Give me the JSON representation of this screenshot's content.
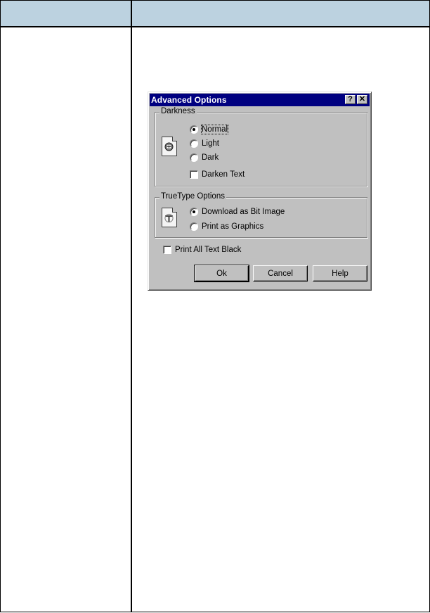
{
  "dialog": {
    "title": "Advanced Options",
    "help_button": "?",
    "close_button": "✕",
    "darkness": {
      "label": "Darkness",
      "options": [
        {
          "label": "Normal",
          "selected": true
        },
        {
          "label": "Light",
          "selected": false
        },
        {
          "label": "Dark",
          "selected": false
        }
      ],
      "darken_text": {
        "label": "Darken Text",
        "checked": false
      }
    },
    "truetype": {
      "label": "TrueType Options",
      "options": [
        {
          "label": "Download as Bit Image",
          "selected": true
        },
        {
          "label": "Print as Graphics",
          "selected": false
        }
      ]
    },
    "print_all_black": {
      "label": "Print All Text Black",
      "checked": false
    },
    "buttons": {
      "ok": "Ok",
      "cancel": "Cancel",
      "help": "Help"
    }
  },
  "colors": {
    "header_fill": "#bcd2e0",
    "title_bar": "#000080",
    "dialog_face": "#c0c0c0"
  }
}
